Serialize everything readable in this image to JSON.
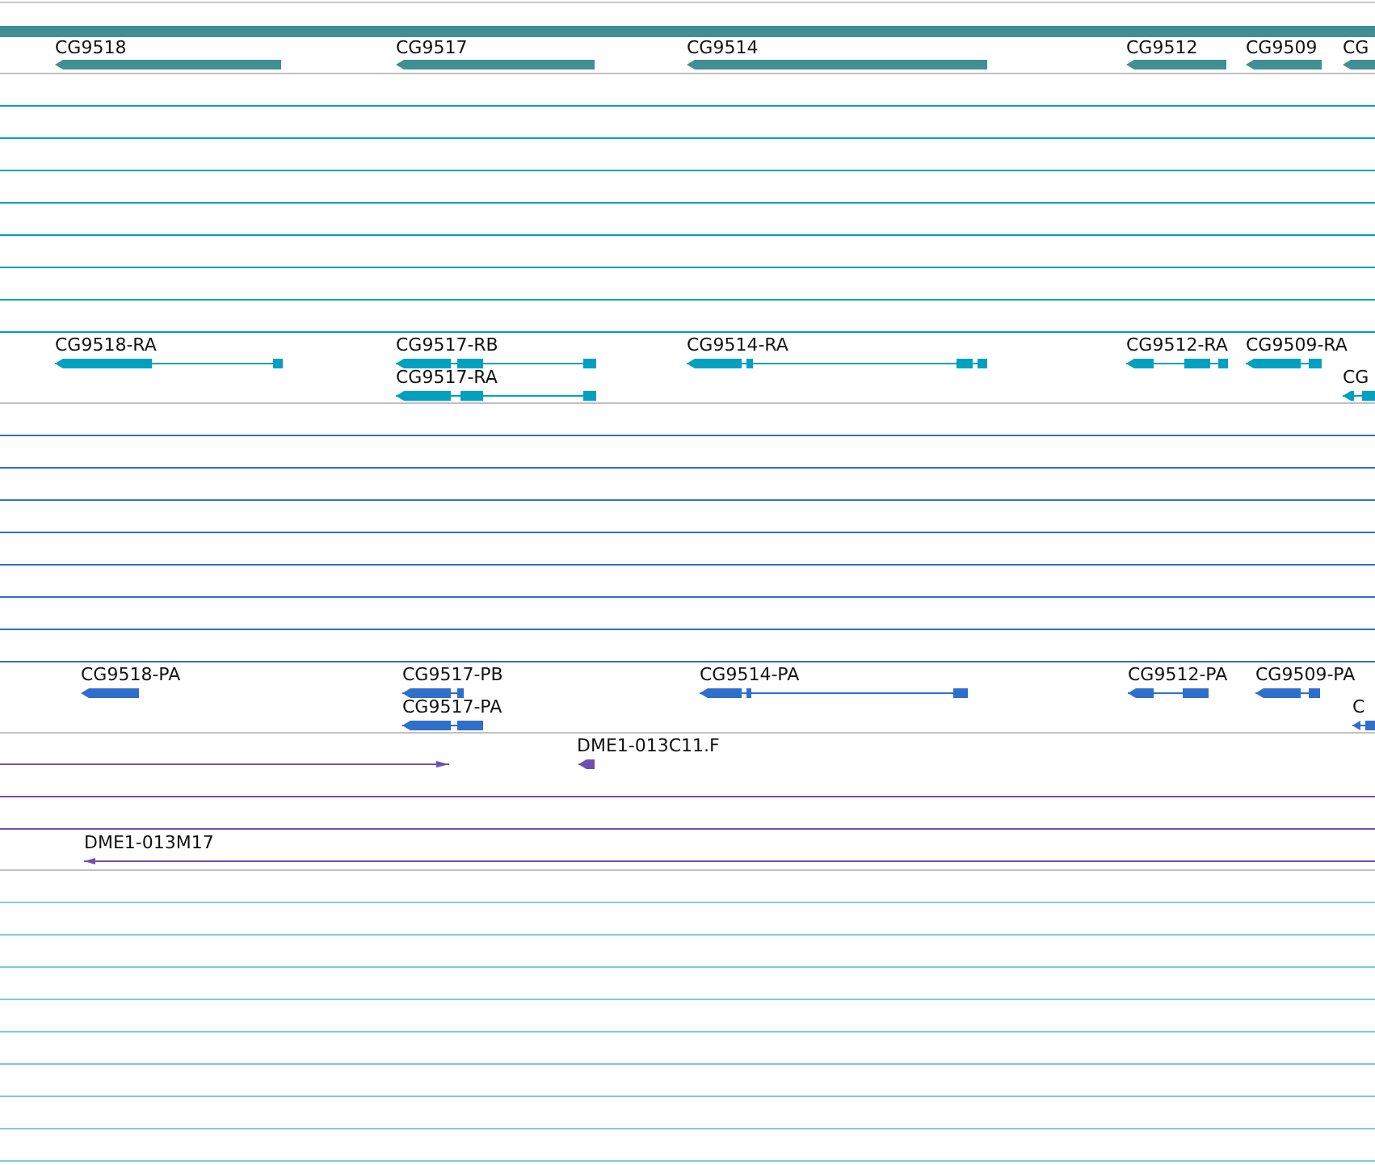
{
  "tracks": [
    {
      "kind": "features",
      "color": "#3f8f94",
      "features": [
        {
          "label": "CG9518",
          "reverse": true
        },
        {
          "label": "CG9517",
          "reverse": true
        },
        {
          "label": "CG9514",
          "reverse": true
        },
        {
          "label": "CG9512",
          "reverse": true
        },
        {
          "label": "CG9509",
          "reverse": true
        },
        {
          "label": "CG",
          "reverse": true
        }
      ]
    },
    {
      "kind": "empty",
      "color": "#00a0c0"
    },
    {
      "kind": "features",
      "color": "#00a0c0",
      "features": [
        {
          "label": "CG9518-RA",
          "reverse": true
        },
        {
          "label": "CG9517-RB",
          "reverse": true
        },
        {
          "label": "CG9517-RA",
          "reverse": true
        },
        {
          "label": "CG9514-RA",
          "reverse": true
        },
        {
          "label": "CG9512-RA",
          "reverse": true
        },
        {
          "label": "CG9509-RA",
          "reverse": true
        },
        {
          "label": "CG",
          "reverse": true
        }
      ]
    },
    {
      "kind": "empty",
      "color": "#2e6fcc"
    },
    {
      "kind": "features",
      "color": "#2e6fcc",
      "features": [
        {
          "label": "CG9518-PA",
          "reverse": true
        },
        {
          "label": "CG9517-PB",
          "reverse": true
        },
        {
          "label": "CG9517-PA",
          "reverse": true
        },
        {
          "label": "CG9514-PA",
          "reverse": true
        },
        {
          "label": "CG9512-PA",
          "reverse": true
        },
        {
          "label": "CG9509-PA",
          "reverse": true
        },
        {
          "label": "C",
          "reverse": true
        }
      ]
    },
    {
      "kind": "features",
      "color": "#7050b0",
      "features": [
        {
          "kind": "clone",
          "reverse": false
        },
        {
          "kind": "clone",
          "label": "DME1-013C11.F",
          "reverse": true
        },
        {
          "kind": "clone"
        },
        {
          "kind": "clone"
        },
        {
          "kind": "clone",
          "label": "DME1-013M17",
          "reverse": true
        }
      ]
    },
    {
      "kind": "empty",
      "color": "#80c8e8"
    }
  ]
}
